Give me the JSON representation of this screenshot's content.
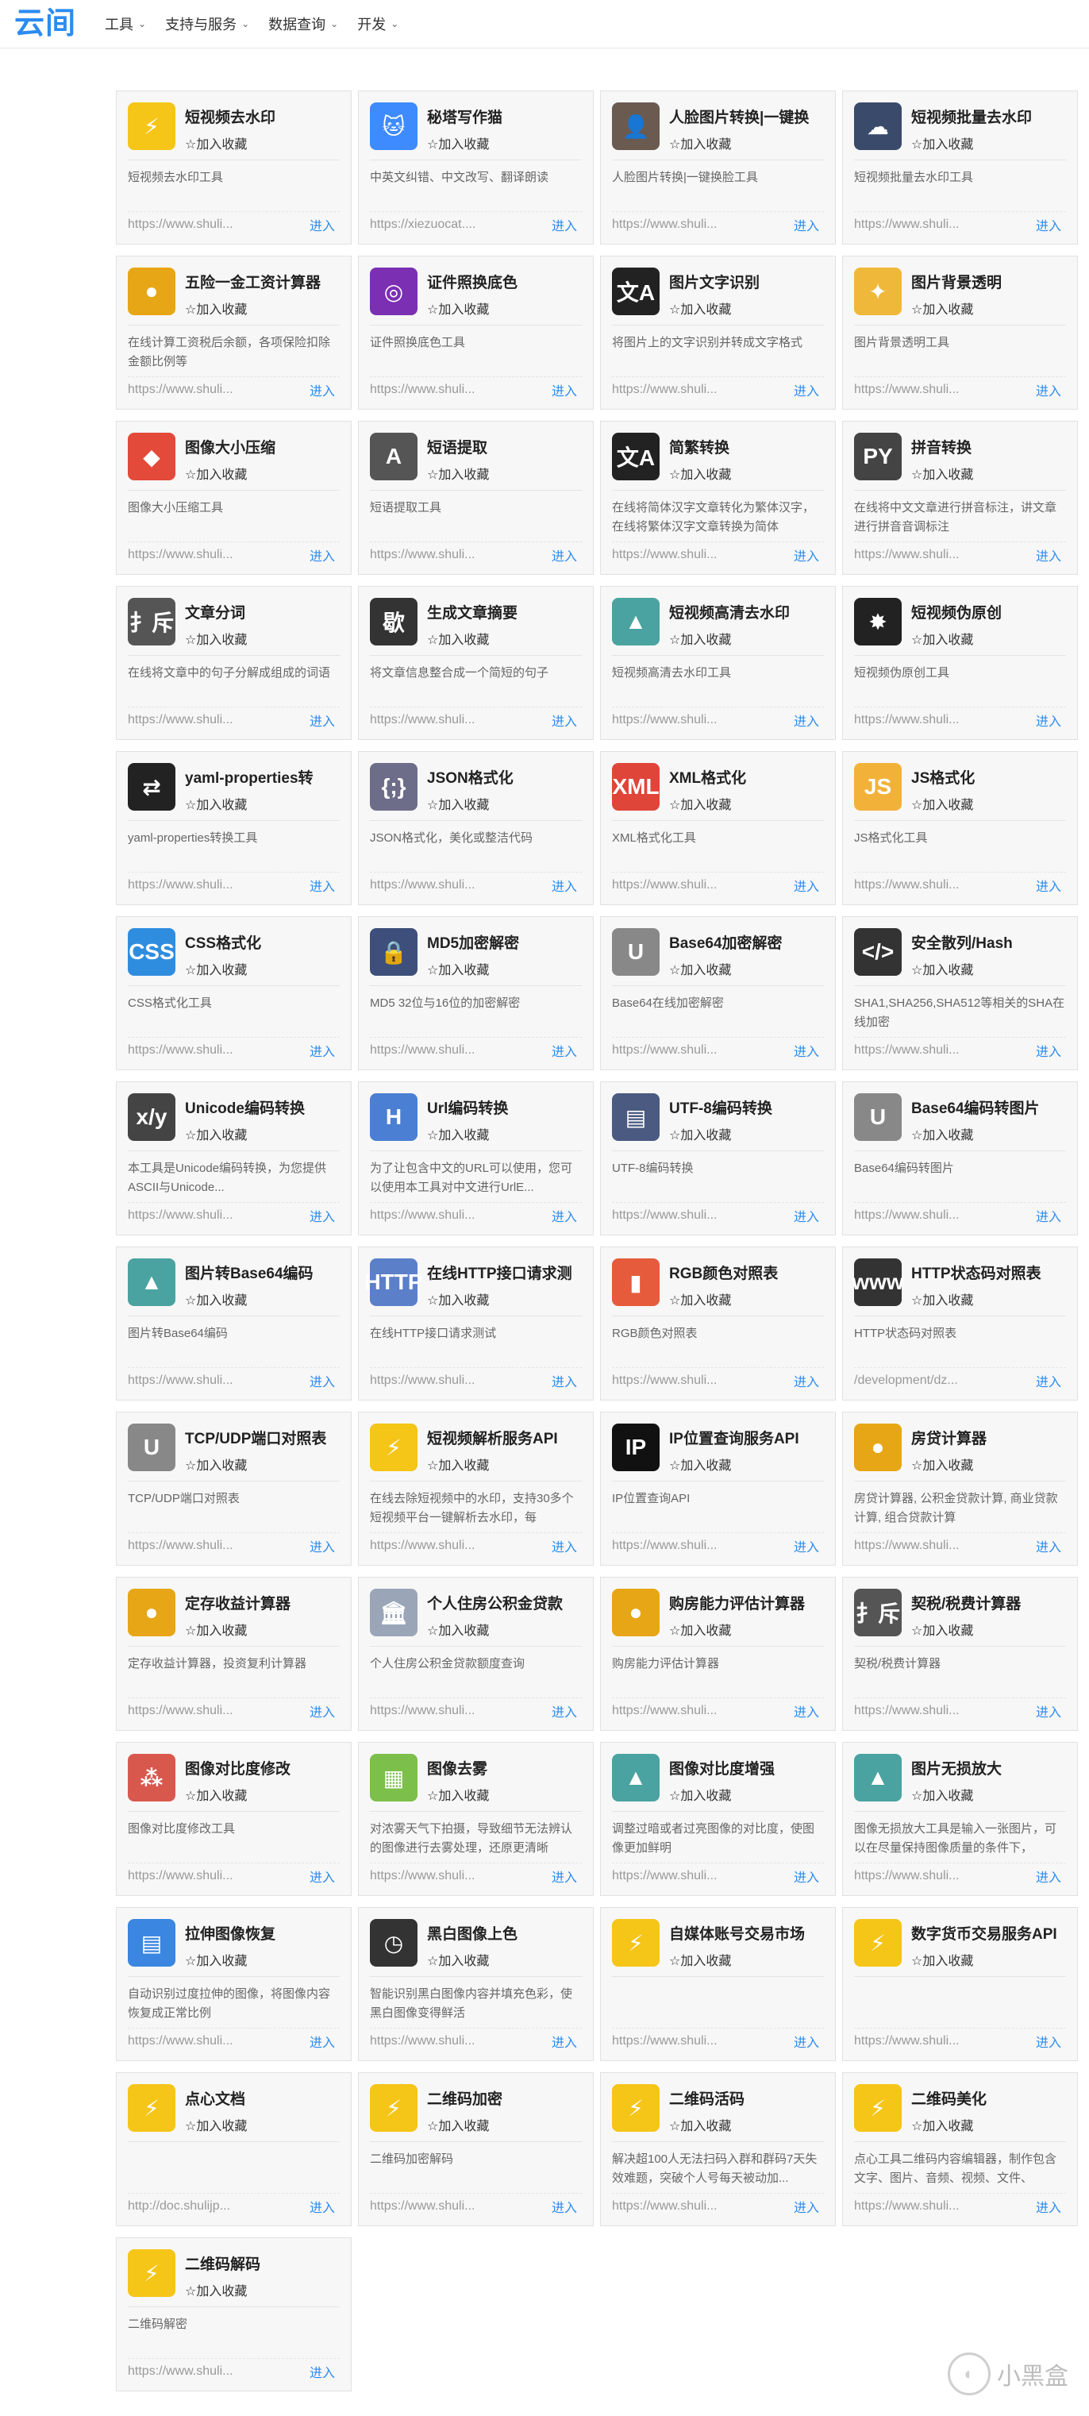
{
  "header": {
    "logo": "云间",
    "nav": [
      {
        "label": "工具",
        "chev": "⌄"
      },
      {
        "label": "支持与服务",
        "chev": "⌄"
      },
      {
        "label": "数据查询",
        "chev": "⌄"
      },
      {
        "label": "开发",
        "chev": "⌄"
      }
    ]
  },
  "fav_label": "☆加入收藏",
  "enter_label": "进入",
  "cards": [
    {
      "title": "短视频去水印",
      "desc": "短视频去水印工具",
      "link": "https://www.shuli...",
      "icon": "pikachu-icon",
      "glyph": "⚡",
      "color": "#f5c518"
    },
    {
      "title": "秘塔写作猫",
      "desc": "中英文纠错、中文改写、翻译朗读",
      "link": "https://xiezuocat....",
      "icon": "cat-icon",
      "glyph": "🐱",
      "color": "#3d8bfd"
    },
    {
      "title": "人脸图片转换|一键换",
      "desc": "人脸图片转换|一键换脸工具",
      "link": "https://www.shuli...",
      "icon": "face-photo-icon",
      "glyph": "👤",
      "color": "#6a5a50"
    },
    {
      "title": "短视频批量去水印",
      "desc": "短视频批量去水印工具",
      "link": "https://www.shuli...",
      "icon": "server-cloud-icon",
      "glyph": "☁",
      "color": "#3a4a6b"
    },
    {
      "title": "五险一金工资计算器",
      "desc": "在线计算工资税后余额，各项保险扣除金额比例等",
      "link": "https://www.shuli...",
      "icon": "coins-icon",
      "glyph": "●",
      "color": "#e7a616"
    },
    {
      "title": "证件照换底色",
      "desc": "证件照换底色工具",
      "link": "https://www.shuli...",
      "icon": "camera-icon",
      "glyph": "◎",
      "color": "#7b2fb3"
    },
    {
      "title": "图片文字识别",
      "desc": "将图片上的文字识别并转成文字格式",
      "link": "https://www.shuli...",
      "icon": "translate-icon",
      "glyph": "文A",
      "color": "#222222"
    },
    {
      "title": "图片背景透明",
      "desc": "图片背景透明工具",
      "link": "https://www.shuli...",
      "icon": "magic-wand-icon",
      "glyph": "✦",
      "color": "#f0b83a"
    },
    {
      "title": "图像大小压缩",
      "desc": "图像大小压缩工具",
      "link": "https://www.shuli...",
      "icon": "compress-icon",
      "glyph": "◆",
      "color": "#e34a3a"
    },
    {
      "title": "短语提取",
      "desc": "短语提取工具",
      "link": "https://www.shuli...",
      "icon": "font-icon",
      "glyph": "A",
      "color": "#555555"
    },
    {
      "title": "简繁转换",
      "desc": "在线将简体汉字文章转化为繁体汉字，在线将繁体汉字文章转换为简体",
      "link": "https://www.shuli...",
      "icon": "translate-icon",
      "glyph": "文A",
      "color": "#222222"
    },
    {
      "title": "拼音转换",
      "desc": "在线将中文文章进行拼音标注，讲文章进行拼音音调标注",
      "link": "https://www.shuli...",
      "icon": "pinyin-icon",
      "glyph": "PY",
      "color": "#444444"
    },
    {
      "title": "文章分词",
      "desc": "在线将文章中的句子分解成组成的词语",
      "link": "https://www.shuli...",
      "icon": "split-icon",
      "glyph": "扌斥",
      "color": "#555555"
    },
    {
      "title": "生成文章摘要",
      "desc": "将文章信息整合成一个简短的句子",
      "link": "https://www.shuli...",
      "icon": "summary-icon",
      "glyph": "歇",
      "color": "#333333"
    },
    {
      "title": "短视频高清去水印",
      "desc": "短视频高清去水印工具",
      "link": "https://www.shuli...",
      "icon": "image-icon",
      "glyph": "▲",
      "color": "#4aa3a0"
    },
    {
      "title": "短视频伪原创",
      "desc": "短视频伪原创工具",
      "link": "https://www.shuli...",
      "icon": "badge-icon",
      "glyph": "✸",
      "color": "#222222"
    },
    {
      "title": "yaml-properties转",
      "desc": "yaml-properties转换工具",
      "link": "https://www.shuli...",
      "icon": "convert-icon",
      "glyph": "⇄",
      "color": "#222222"
    },
    {
      "title": "JSON格式化",
      "desc": "JSON格式化，美化或整洁代码",
      "link": "https://www.shuli...",
      "icon": "json-file-icon",
      "glyph": "{;}",
      "color": "#6d6d8a"
    },
    {
      "title": "XML格式化",
      "desc": "XML格式化工具",
      "link": "https://www.shuli...",
      "icon": "xml-file-icon",
      "glyph": "XML",
      "color": "#e0453a"
    },
    {
      "title": "JS格式化",
      "desc": "JS格式化工具",
      "link": "https://www.shuli...",
      "icon": "js-file-icon",
      "glyph": "JS",
      "color": "#f2b23a"
    },
    {
      "title": "CSS格式化",
      "desc": "CSS格式化工具",
      "link": "https://www.shuli...",
      "icon": "css-file-icon",
      "glyph": "CSS",
      "color": "#2f8de0"
    },
    {
      "title": "MD5加密解密",
      "desc": "MD5 32位与16位的加密解密",
      "link": "https://www.shuli...",
      "icon": "lock-icon",
      "glyph": "🔒",
      "color": "#3d4f7a"
    },
    {
      "title": "Base64加密解密",
      "desc": "Base64在线加密解密",
      "link": "https://www.shuli...",
      "icon": "u-logo-icon",
      "glyph": "U",
      "color": "#888888"
    },
    {
      "title": "安全散列/Hash",
      "desc": "SHA1,SHA256,SHA512等相关的SHA在线加密",
      "link": "https://www.shuli...",
      "icon": "code-gear-icon",
      "glyph": "</>",
      "color": "#333333"
    },
    {
      "title": "Unicode编码转换",
      "desc": "本工具是Unicode编码转换，为您提供ASCII与Unicode...",
      "link": "https://www.shuli...",
      "icon": "xy-icon",
      "glyph": "x/y",
      "color": "#444444"
    },
    {
      "title": "Url编码转换",
      "desc": "为了让包含中文的URL可以使用，您可以使用本工具对中文进行UrlE...",
      "link": "https://www.shuli...",
      "icon": "h-doc-icon",
      "glyph": "H",
      "color": "#4a7fd4"
    },
    {
      "title": "UTF-8编码转换",
      "desc": "UTF-8编码转换",
      "link": "https://www.shuli...",
      "icon": "monitor-icon",
      "glyph": "▤",
      "color": "#4a5a80"
    },
    {
      "title": "Base64编码转图片",
      "desc": "Base64编码转图片",
      "link": "https://www.shuli...",
      "icon": "u-logo-icon",
      "glyph": "U",
      "color": "#888888"
    },
    {
      "title": "图片转Base64编码",
      "desc": "图片转Base64编码",
      "link": "https://www.shuli...",
      "icon": "image-icon",
      "glyph": "▲",
      "color": "#4aa3a0"
    },
    {
      "title": "在线HTTP接口请求测",
      "desc": "在线HTTP接口请求测试",
      "link": "https://www.shuli...",
      "icon": "http-monitor-icon",
      "glyph": "HTTP",
      "color": "#5b7fc9"
    },
    {
      "title": "RGB颜色对照表",
      "desc": "RGB颜色对照表",
      "link": "https://www.shuli...",
      "icon": "palette-icon",
      "glyph": "▮",
      "color": "#e55b3c"
    },
    {
      "title": "HTTP状态码对照表",
      "desc": "HTTP状态码对照表",
      "link": "/development/dz...",
      "icon": "www-icon",
      "glyph": "www",
      "color": "#333333"
    },
    {
      "title": "TCP/UDP端口对照表",
      "desc": "TCP/UDP端口对照表",
      "link": "https://www.shuli...",
      "icon": "u-logo-icon",
      "glyph": "U",
      "color": "#888888"
    },
    {
      "title": "短视频解析服务API",
      "desc": "在线去除短视频中的水印，支持30多个短视频平台一键解析去水印，每",
      "link": "https://www.shuli...",
      "icon": "pikachu-icon",
      "glyph": "⚡",
      "color": "#f5c518"
    },
    {
      "title": "IP位置查询服务API",
      "desc": "IP位置查询API",
      "link": "https://www.shuli...",
      "icon": "location-pin-icon",
      "glyph": "IP",
      "color": "#111111"
    },
    {
      "title": "房贷计算器",
      "desc": "房贷计算器, 公积金贷款计算, 商业贷款计算, 组合贷款计算",
      "link": "https://www.shuli...",
      "icon": "coins-icon",
      "glyph": "●",
      "color": "#e7a616"
    },
    {
      "title": "定存收益计算器",
      "desc": "定存收益计算器，投资复利计算器",
      "link": "https://www.shuli...",
      "icon": "coins-icon",
      "glyph": "●",
      "color": "#e7a616"
    },
    {
      "title": "个人住房公积金贷款",
      "desc": "个人住房公积金贷款额度查询",
      "link": "https://www.shuli...",
      "icon": "bank-icon",
      "glyph": "🏛",
      "color": "#9aa6b8"
    },
    {
      "title": "购房能力评估计算器",
      "desc": "购房能力评估计算器",
      "link": "https://www.shuli...",
      "icon": "coins-icon",
      "glyph": "●",
      "color": "#e7a616"
    },
    {
      "title": "契税/税费计算器",
      "desc": "契税/税费计算器",
      "link": "https://www.shuli...",
      "icon": "split-icon",
      "glyph": "扌斥",
      "color": "#555555"
    },
    {
      "title": "图像对比度修改",
      "desc": "图像对比度修改工具",
      "link": "https://www.shuli...",
      "icon": "dots-icon",
      "glyph": "⁂",
      "color": "#d9584e"
    },
    {
      "title": "图像去雾",
      "desc": "对浓雾天气下拍摄，导致细节无法辨认的图像进行去雾处理，还原更清晰",
      "link": "https://www.shuli...",
      "icon": "spreadsheet-icon",
      "glyph": "▦",
      "color": "#7cbf4a"
    },
    {
      "title": "图像对比度增强",
      "desc": "调整过暗或者过亮图像的对比度，使图像更加鲜明",
      "link": "https://www.shuli...",
      "icon": "image-icon",
      "glyph": "▲",
      "color": "#4aa3a0"
    },
    {
      "title": "图片无损放大",
      "desc": "图像无损放大工具是输入一张图片，可以在尽量保持图像质量的条件下，",
      "link": "https://www.shuli...",
      "icon": "image-icon",
      "glyph": "▲",
      "color": "#4aa3a0"
    },
    {
      "title": "拉伸图像恢复",
      "desc": "自动识别过度拉伸的图像，将图像内容恢复成正常比例",
      "link": "https://www.shuli...",
      "icon": "doc-circle-icon",
      "glyph": "▤",
      "color": "#3a86e0"
    },
    {
      "title": "黑白图像上色",
      "desc": "智能识别黑白图像内容并填充色彩，使黑白图像变得鲜活",
      "link": "https://www.shuli...",
      "icon": "clock-icon",
      "glyph": "◷",
      "color": "#333333"
    },
    {
      "title": "自媒体账号交易市场",
      "desc": "",
      "link": "https://www.shuli...",
      "icon": "pikachu-icon",
      "glyph": "⚡",
      "color": "#f5c518"
    },
    {
      "title": "数字货币交易服务API",
      "desc": "",
      "link": "https://www.shuli...",
      "icon": "pikachu-icon",
      "glyph": "⚡",
      "color": "#f5c518"
    },
    {
      "title": "点心文档",
      "desc": "",
      "link": "http://doc.shulijp...",
      "icon": "pikachu-icon",
      "glyph": "⚡",
      "color": "#f5c518"
    },
    {
      "title": "二维码加密",
      "desc": "二维码加密解码",
      "link": "https://www.shuli...",
      "icon": "pikachu-icon",
      "glyph": "⚡",
      "color": "#f5c518"
    },
    {
      "title": "二维码活码",
      "desc": "解决超100人无法扫码入群和群码7天失效难题，突破个人号每天被动加...",
      "link": "https://www.shuli...",
      "icon": "pikachu-icon",
      "glyph": "⚡",
      "color": "#f5c518"
    },
    {
      "title": "二维码美化",
      "desc": "点心工具二维码内容编辑器，制作包含文字、图片、音频、视频、文件、",
      "link": "https://www.shuli...",
      "icon": "pikachu-icon",
      "glyph": "⚡",
      "color": "#f5c518"
    },
    {
      "title": "二维码解码",
      "desc": "二维码解密",
      "link": "https://www.shuli...",
      "icon": "pikachu-icon",
      "glyph": "⚡",
      "color": "#f5c518"
    }
  ],
  "watermark": {
    "text": "小黑盒",
    "glyph": "◐"
  }
}
